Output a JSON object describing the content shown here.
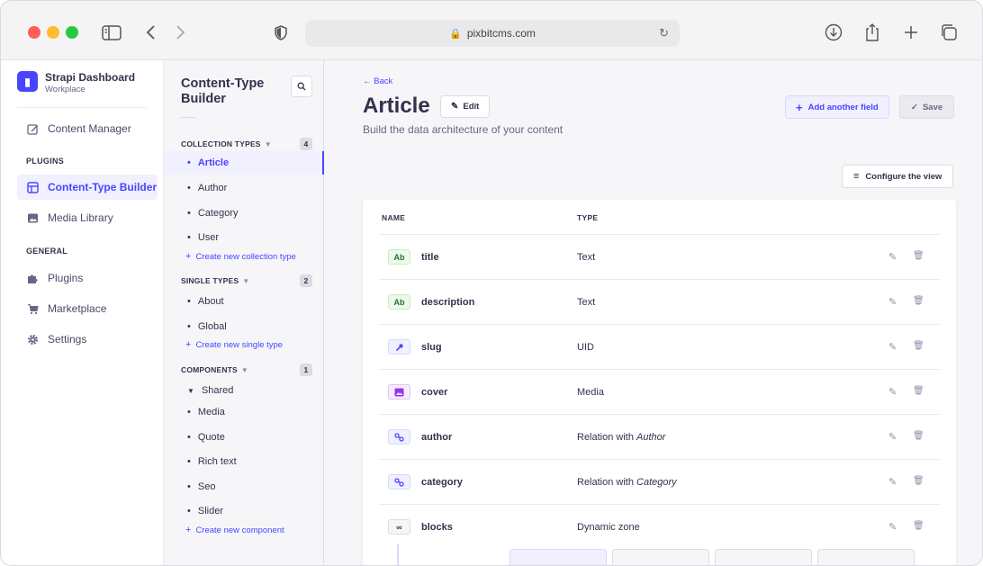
{
  "browser": {
    "url": "pixbitcms.com"
  },
  "brand": {
    "title": "Strapi Dashboard",
    "subtitle": "Workplace"
  },
  "leftnav": {
    "content_manager": "Content Manager",
    "plugins_section": "PLUGINS",
    "content_type_builder": "Content-Type Builder",
    "media_library": "Media Library",
    "general_section": "GENERAL",
    "plugins": "Plugins",
    "marketplace": "Marketplace",
    "settings": "Settings"
  },
  "subnav": {
    "title": "Content-Type Builder",
    "collection_types": {
      "label": "COLLECTION TYPES",
      "count": "4",
      "items": [
        "Article",
        "Author",
        "Category",
        "User"
      ],
      "create": "Create new collection type"
    },
    "single_types": {
      "label": "SINGLE TYPES",
      "count": "2",
      "items": [
        "About",
        "Global"
      ],
      "create": "Create new single type"
    },
    "components": {
      "label": "COMPONENTS",
      "count": "1",
      "group": "Shared",
      "items": [
        "Media",
        "Quote",
        "Rich text",
        "Seo",
        "Slider"
      ],
      "create": "Create new component"
    }
  },
  "main": {
    "back": "Back",
    "title": "Article",
    "edit": "Edit",
    "subtitle": "Build the data architecture of your content",
    "add_field": "Add another field",
    "save": "Save",
    "configure": "Configure the view",
    "col_name": "NAME",
    "col_type": "TYPE",
    "fields": [
      {
        "badge": "Ab",
        "name": "title",
        "type": "Text",
        "target": ""
      },
      {
        "badge": "Ab",
        "name": "description",
        "type": "Text",
        "target": ""
      },
      {
        "badge": "🔑",
        "name": "slug",
        "type": "UID",
        "target": ""
      },
      {
        "badge": "▣",
        "name": "cover",
        "type": "Media",
        "target": ""
      },
      {
        "badge": "%",
        "name": "author",
        "type": "Relation with ",
        "target": "Author"
      },
      {
        "badge": "%",
        "name": "category",
        "type": "Relation with ",
        "target": "Category"
      },
      {
        "badge": "∞",
        "name": "blocks",
        "type": "Dynamic zone",
        "target": ""
      }
    ]
  }
}
